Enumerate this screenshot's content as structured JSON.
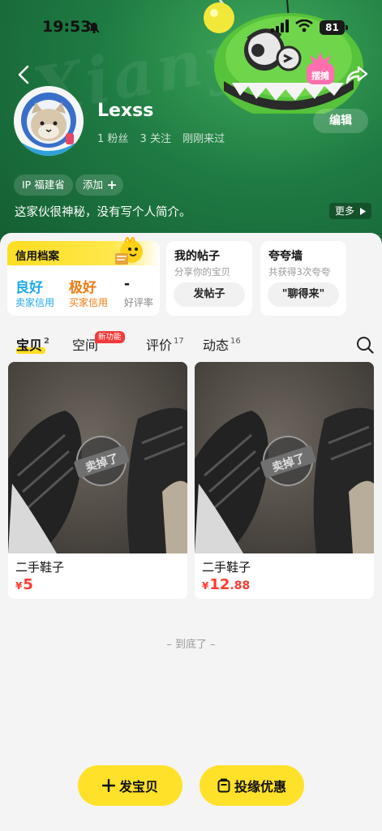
{
  "status_bar": {
    "time": "19:53",
    "battery": "81"
  },
  "profile": {
    "username": "Lexss",
    "stats": [
      "1 粉丝",
      "3 关注",
      "刚刚来过"
    ],
    "edit_label": "编辑",
    "ip_tag": "IP 福建省",
    "add_tag": "添加",
    "bio": "这家伙很神秘，没有写个人简介。",
    "more_label": "更多",
    "mascot_badge": "摆摊"
  },
  "credit": {
    "title": "信用档案",
    "items": [
      {
        "value": "良好",
        "label": "卖家信用",
        "color": "#1fa9e8"
      },
      {
        "value": "极好",
        "label": "买家信用",
        "color": "#f07a10"
      },
      {
        "value": "-",
        "label": "好评率",
        "color": "#111111"
      }
    ]
  },
  "posts_card": {
    "title": "我的帖子",
    "subtitle": "分享你的宝贝",
    "button": "发帖子"
  },
  "praise_card": {
    "title": "夸夸墙",
    "subtitle": "共获得3次夸夸",
    "button": "\"聊得来\""
  },
  "tabs": [
    {
      "label": "宝贝",
      "count": "2",
      "active": true
    },
    {
      "label": "空间",
      "count": "",
      "badge": "新功能"
    },
    {
      "label": "评价",
      "count": "17"
    },
    {
      "label": "动态",
      "count": "16"
    }
  ],
  "products": [
    {
      "title": "二手鞋子",
      "currency": "¥",
      "price_int": "5",
      "price_dec": "",
      "sold_stamp": "卖掉了"
    },
    {
      "title": "二手鞋子",
      "currency": "¥",
      "price_int": "12",
      "price_dec": ".88",
      "sold_stamp": "卖掉了"
    }
  ],
  "end_text": "– 到底了 –",
  "bottom": {
    "publish_label": "发宝贝",
    "promo_label": "投缘优惠"
  },
  "colors": {
    "accent": "#ffe12a",
    "header_green": "#1e7a42",
    "price_red": "#ff3b30"
  }
}
